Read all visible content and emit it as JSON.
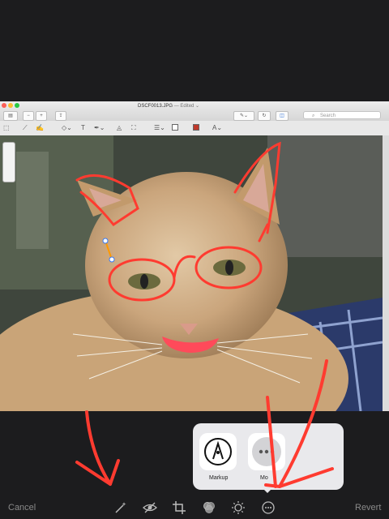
{
  "window": {
    "file_name": "DSCF0013.JPG",
    "edited_label": "— Edited ⌄",
    "search_placeholder": "Search"
  },
  "popover": {
    "items": [
      {
        "label": "Markup",
        "icon": "markup-pen-icon"
      },
      {
        "label": "Mo",
        "icon": "more-dots-icon"
      }
    ]
  },
  "bottom_bar": {
    "cancel_label": "Cancel",
    "revert_label": "Revert",
    "tools": [
      "magic-wand-icon",
      "red-eye-icon",
      "crop-icon",
      "filters-icon",
      "adjust-icon",
      "more-icon"
    ]
  },
  "colors": {
    "background": "#1c1c1e",
    "annotation_red": "#ff3b30",
    "inactive_text": "#8a8a8a"
  }
}
